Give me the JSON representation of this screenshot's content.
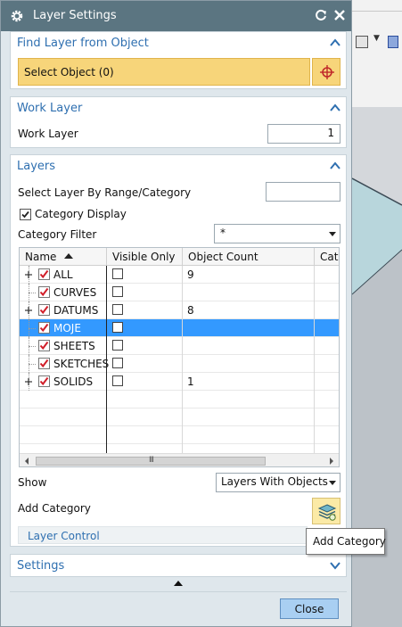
{
  "dialog": {
    "title": "Layer Settings",
    "reset_icon": "reset-icon",
    "close_icon": "close-icon"
  },
  "find_layer": {
    "section_title": "Find Layer from Object",
    "select_object_label": "Select Object (0)"
  },
  "work_layer": {
    "section_title": "Work Layer",
    "label": "Work Layer",
    "value": "1"
  },
  "layers": {
    "section_title": "Layers",
    "range_label": "Select Layer By Range/Category",
    "range_value": "",
    "category_display_label": "Category Display",
    "category_display_checked": true,
    "category_filter_label": "Category Filter",
    "category_filter_value": "*",
    "table": {
      "columns": [
        "Name",
        "Visible Only",
        "Object Count",
        "Cat"
      ],
      "rows": [
        {
          "name": "ALL",
          "expandable": true,
          "visible_only": false,
          "object_count": "9",
          "selected": false
        },
        {
          "name": "CURVES",
          "expandable": false,
          "visible_only": false,
          "object_count": "",
          "selected": false
        },
        {
          "name": "DATUMS",
          "expandable": true,
          "visible_only": false,
          "object_count": "8",
          "selected": false
        },
        {
          "name": "MOJE",
          "expandable": false,
          "visible_only": false,
          "object_count": "",
          "selected": true
        },
        {
          "name": "SHEETS",
          "expandable": false,
          "visible_only": false,
          "object_count": "",
          "selected": false
        },
        {
          "name": "SKETCHES",
          "expandable": false,
          "visible_only": false,
          "object_count": "",
          "selected": false
        },
        {
          "name": "SOLIDS",
          "expandable": true,
          "visible_only": false,
          "object_count": "1",
          "selected": false
        }
      ],
      "scroll_grip": "III"
    },
    "show_label": "Show",
    "show_value": "Layers With Objects",
    "add_category_label": "Add Category",
    "layer_control_label": "Layer Control"
  },
  "settings": {
    "section_title": "Settings"
  },
  "footer": {
    "close_label": "Close"
  },
  "tooltip": {
    "text": "Add Category"
  },
  "colors": {
    "title_bar": "#5b7581",
    "section_title": "#2e6fb0",
    "selection_highlight": "#f7d57a",
    "row_selected": "#3399ff",
    "close_button": "#a9cff2"
  }
}
